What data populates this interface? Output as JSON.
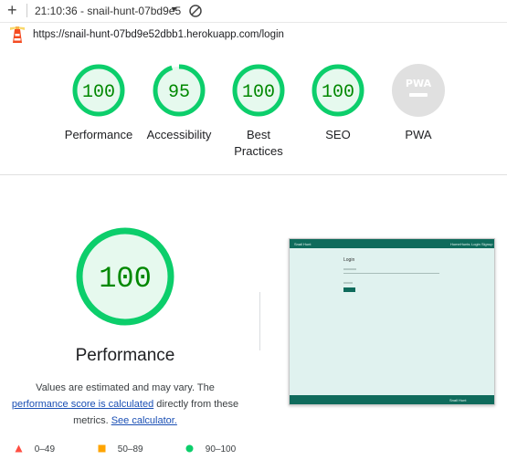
{
  "topbar": {
    "session": "21:10:36 - snail-hunt-07bd9e5"
  },
  "urlbar": {
    "url": "https://snail-hunt-07bd9e52dbb1.herokuapp.com/login"
  },
  "categories": [
    {
      "score": "100",
      "label": "Performance",
      "fraction": 1.0,
      "color": "#0cce6b"
    },
    {
      "score": "95",
      "label": "Accessibility",
      "fraction": 0.95,
      "color": "#0cce6b"
    },
    {
      "score": "100",
      "label_line1": "Best",
      "label_line2": "Practices",
      "fraction": 1.0,
      "color": "#0cce6b"
    },
    {
      "score": "100",
      "label": "SEO",
      "fraction": 1.0,
      "color": "#0cce6b"
    },
    {
      "score": "PWA",
      "label": "PWA",
      "color": "#cccccc"
    }
  ],
  "performance": {
    "score": "100",
    "title": "Performance",
    "desc_line1": "Values are estimated and may vary. The",
    "desc_link1": "performance score is calculated",
    "desc_line2_rest": " directly from these",
    "desc_line3_pre": "metrics. ",
    "desc_link2": "See calculator."
  },
  "thumbnail": {
    "brand": "Snail Hunt",
    "heading": "Login",
    "nav_items": [
      "Home",
      "Hunts",
      "Login",
      "Signup"
    ],
    "footer_text": "Snail Hunt"
  },
  "legend": [
    {
      "range": "0–49",
      "shape": "triangle",
      "color": "#ff4e42"
    },
    {
      "range": "50–89",
      "shape": "square",
      "color": "#ffa400"
    },
    {
      "range": "90–100",
      "shape": "circle",
      "color": "#0cce6b"
    }
  ]
}
